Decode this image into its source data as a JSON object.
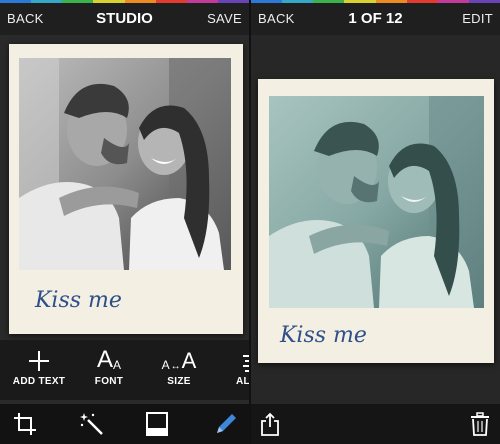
{
  "colors": {
    "rainbow": [
      "#2b7ad8",
      "#35a7c8",
      "#3bb24a",
      "#d9d12f",
      "#ee8a22",
      "#e33b2f",
      "#c23a9a",
      "#6a43b7"
    ],
    "accent_blue": "#3d88d9",
    "caption_ink": "#2f4f8a"
  },
  "studio": {
    "back_label": "BACK",
    "title": "STUDIO",
    "save_label": "SAVE",
    "caption": "Kiss me",
    "tools": [
      {
        "icon": "plus-icon",
        "label": "ADD TEXT"
      },
      {
        "icon": "font-icon",
        "label": "FONT"
      },
      {
        "icon": "text-size-icon",
        "label": "SIZE"
      },
      {
        "icon": "align-icon",
        "label": "ALI"
      }
    ],
    "bottom_icons": [
      "crop-icon",
      "magic-wand-icon",
      "frame-icon",
      "pencil-icon"
    ]
  },
  "viewer": {
    "back_label": "BACK",
    "title": "1 OF 12",
    "edit_label": "EDIT",
    "caption": "Kiss me",
    "bottom_icons": [
      "share-icon",
      "trash-icon"
    ]
  }
}
